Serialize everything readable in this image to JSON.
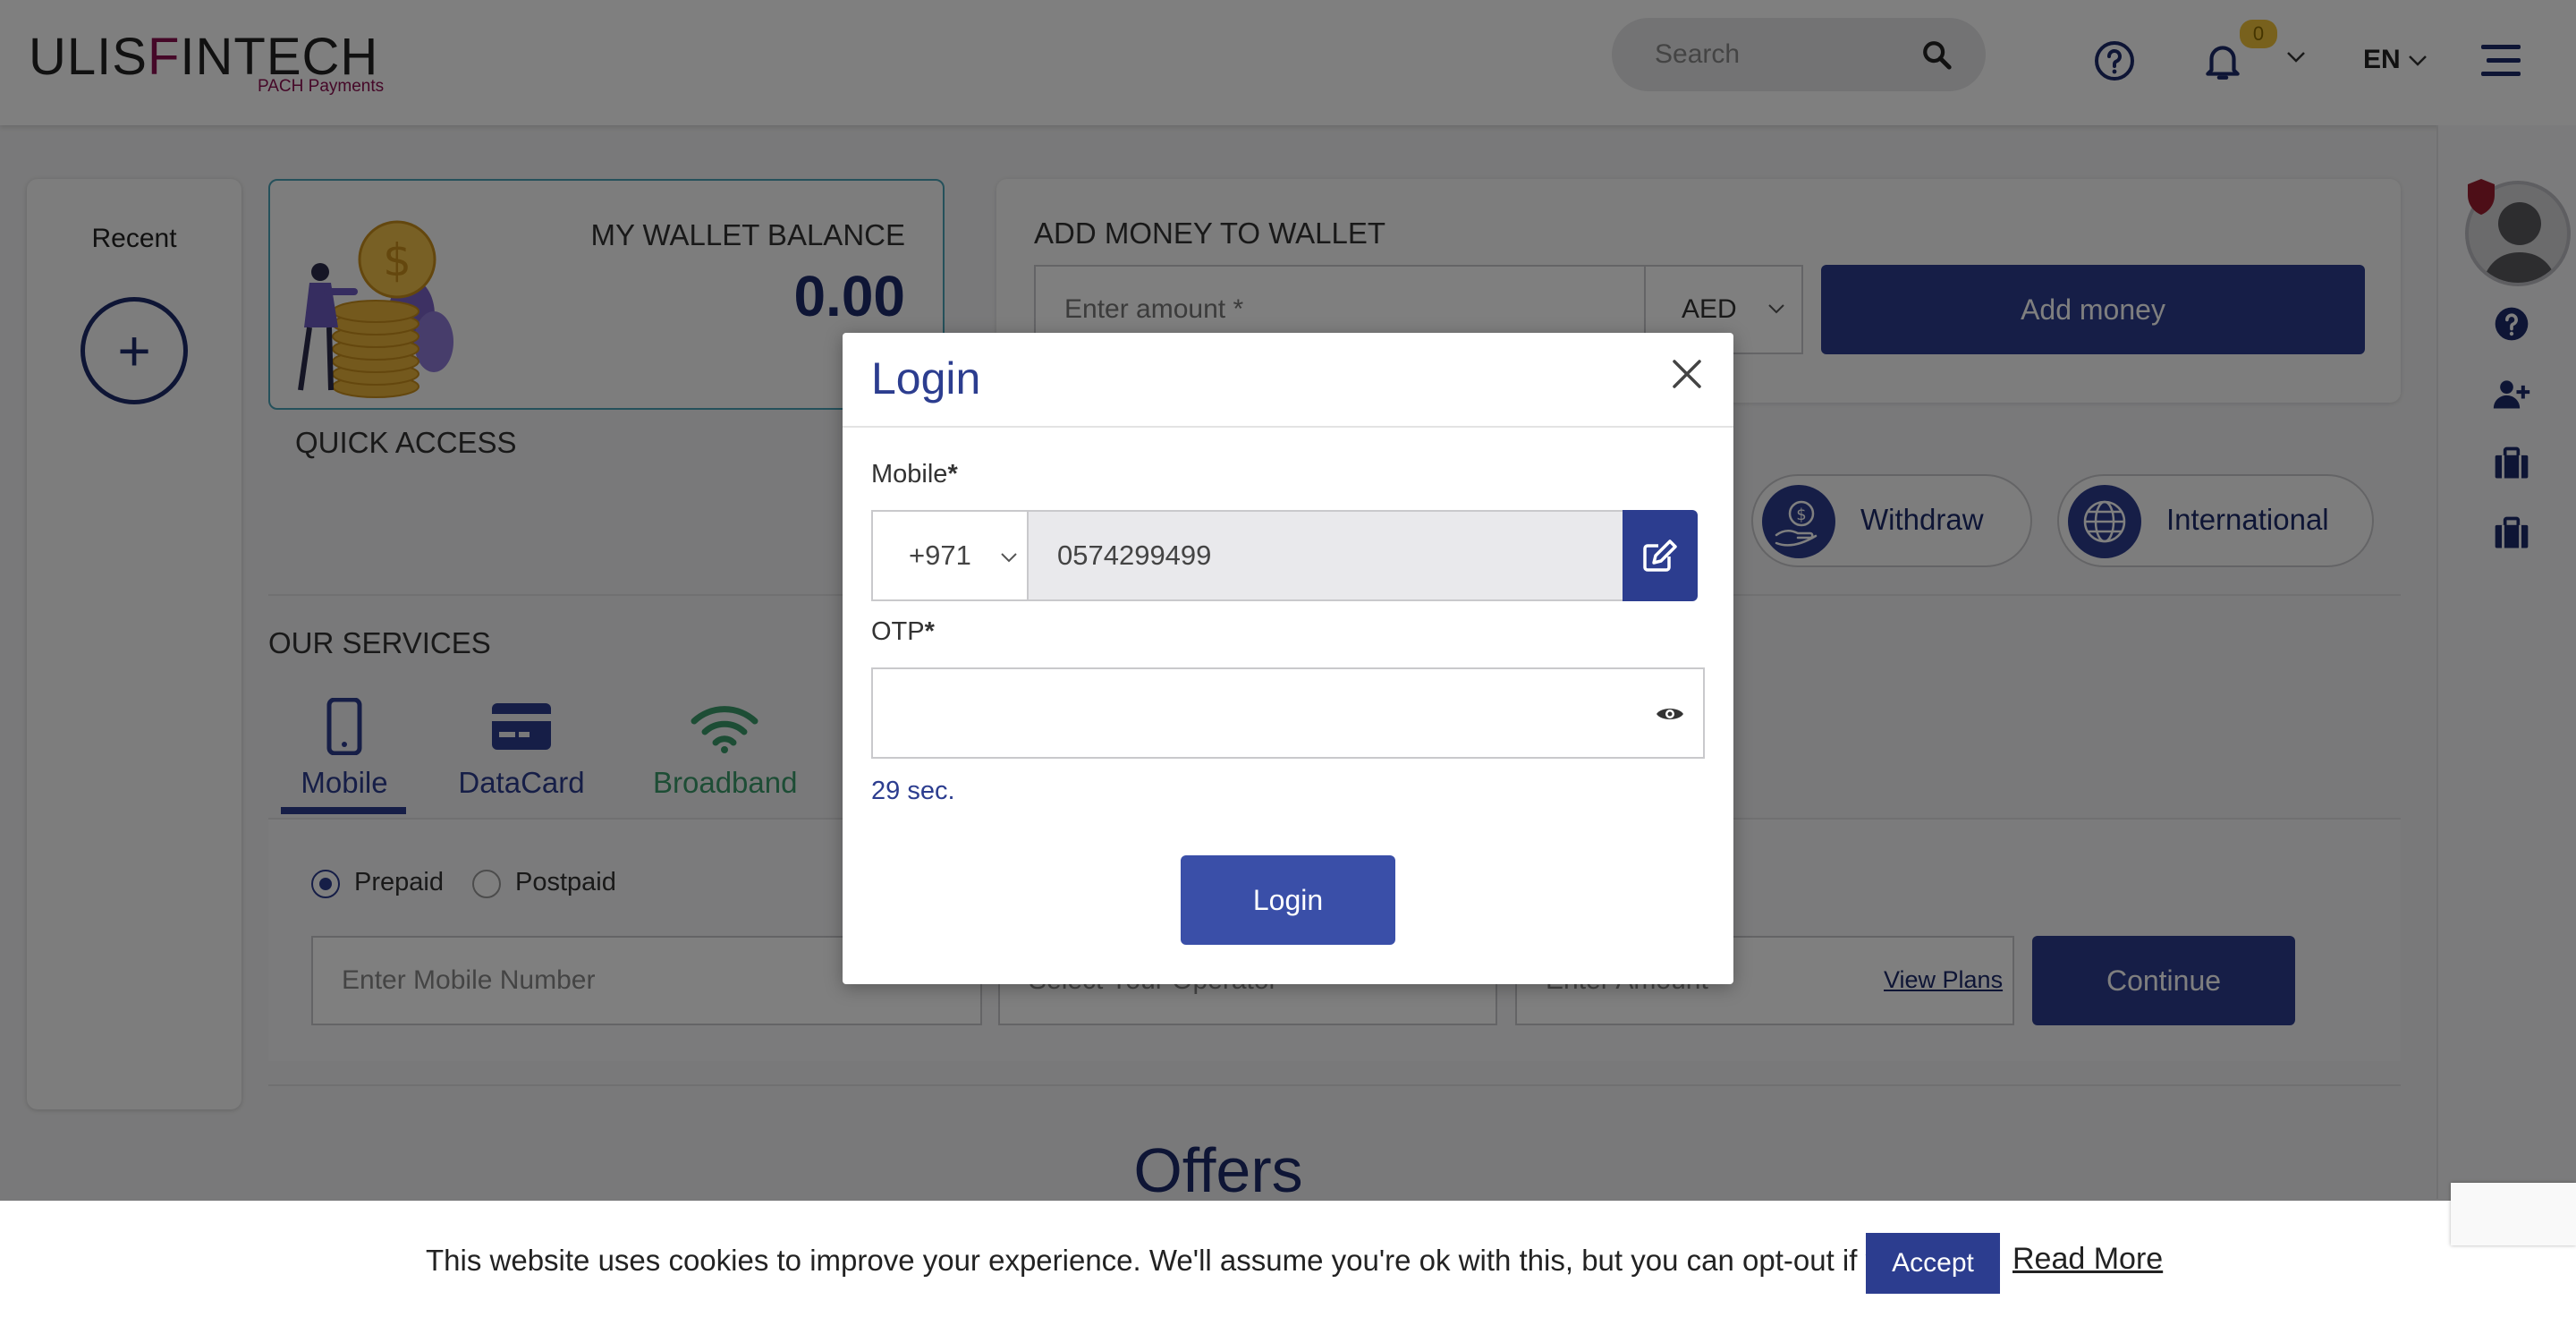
{
  "header": {
    "logo_main_a": "ULIS",
    "logo_main_b": "F",
    "logo_main_c": "INTECH",
    "logo_sub": "PACH Payments",
    "search_placeholder": "Search",
    "notifications_count": "0",
    "language": "EN"
  },
  "recent": {
    "title": "Recent",
    "add_symbol": "+"
  },
  "wallet": {
    "title": "MY WALLET BALANCE",
    "amount": "0.00"
  },
  "add_money": {
    "title": "ADD MONEY TO WALLET",
    "amount_placeholder": "Enter amount *",
    "currency": "AED",
    "button": "Add money"
  },
  "quick_access": {
    "title": "QUICK ACCESS",
    "items": [
      {
        "label": "Withdraw",
        "icon": "withdraw-icon"
      },
      {
        "label": "International",
        "icon": "globe-icon"
      }
    ]
  },
  "services": {
    "title": "OUR SERVICES",
    "tabs": [
      {
        "label": "Mobile",
        "icon": "mobile-icon",
        "active": true
      },
      {
        "label": "DataCard",
        "icon": "card-icon"
      },
      {
        "label": "Broadband",
        "icon": "wifi-icon"
      }
    ],
    "plan_types": [
      "Prepaid",
      "Postpaid"
    ],
    "selected_plan": "Prepaid",
    "mobile_placeholder": "Enter Mobile Number",
    "operator_placeholder": "Select Your Operator",
    "amount_placeholder": "Enter Amount",
    "view_plans": "View Plans",
    "continue": "Continue"
  },
  "offers_title": "Offers",
  "login_modal": {
    "title": "Login",
    "mobile_label": "Mobile",
    "required_mark": "*",
    "country_code": "+971",
    "mobile_value": "0574299499",
    "otp_label": "OTP",
    "timer": "29 sec.",
    "login_button": "Login"
  },
  "cookie": {
    "text": "This website uses cookies to improve your experience. We'll assume you're ok with this, but you can opt-out if you wish.",
    "accept": "Accept",
    "read_more": "Read More"
  },
  "colors": {
    "primary": "#2c3d8f",
    "brand_magenta": "#8a1050",
    "badge": "#f0c33a",
    "broadband_green": "#3a9a6a"
  }
}
